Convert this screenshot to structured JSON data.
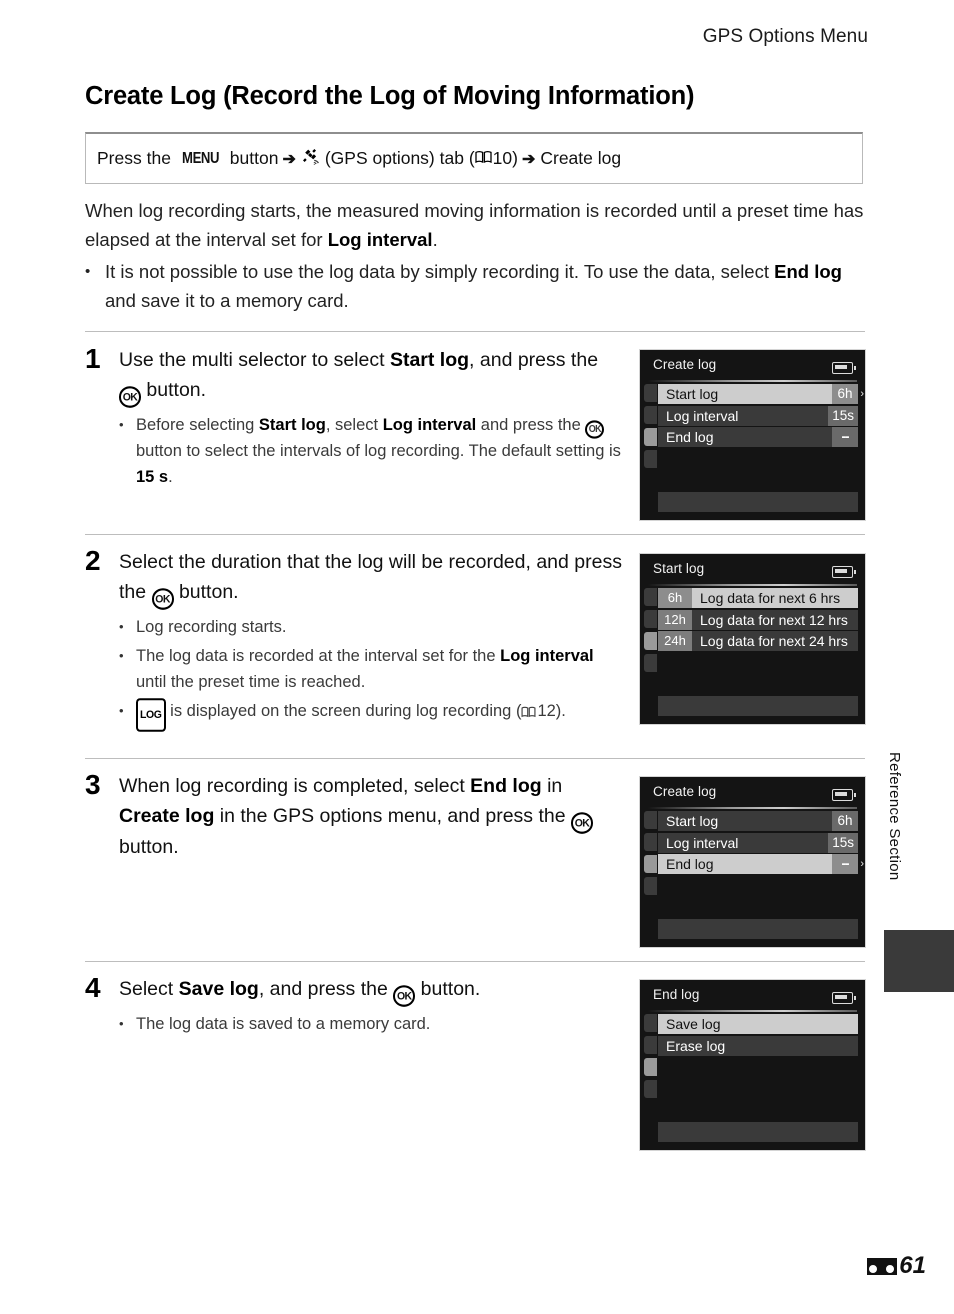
{
  "header": {
    "running_title": "GPS Options Menu"
  },
  "section": {
    "title": "Create Log (Record the Log of Moving Information)"
  },
  "path_box": {
    "press_the": "Press the",
    "menu_label": "MENU",
    "button_word": "button",
    "arrow": "➔",
    "gps_icon": "satellite-icon",
    "gps_tab_label": "(GPS options) tab (",
    "book_icon": "book-icon",
    "page_ref": "10)",
    "close_paren": "",
    "arrow2": "➔",
    "destination": "Create log"
  },
  "intro": {
    "paragraph_a": "When log recording starts, the measured moving information is recorded until a preset time has elapsed at the interval set for ",
    "paragraph_a_bold": "Log interval",
    "paragraph_a_end": ".",
    "bullet_dot": "•",
    "bullet_a": "It is not possible to use the log data by simply recording it. To use the data, select ",
    "bullet_a_bold": "End log",
    "bullet_a_end": " and save it to a memory card."
  },
  "steps": [
    {
      "number": "1",
      "head_pre": "Use the multi selector to select ",
      "head_bold": "Start log",
      "head_mid": ", and press the ",
      "ok_glyph": "OK",
      "head_end": " button.",
      "subs": [
        {
          "dot": "•",
          "pre": "Before selecting ",
          "b1": "Start log",
          "mid1": ", select ",
          "b2": "Log interval",
          "mid2": " and press the ",
          "ok": "OK",
          "mid3": " button to select the intervals of log recording. The default setting is ",
          "b3": "15 s",
          "end": "."
        }
      ]
    },
    {
      "number": "2",
      "head_pre": "Select the duration that the log will be recorded, and press the ",
      "ok_glyph": "OK",
      "head_end": " button.",
      "subs": [
        {
          "dot": "•",
          "text": "Log recording starts."
        },
        {
          "dot": "•",
          "pre": "The log data is recorded at the interval set for the ",
          "b1": "Log interval",
          "end": " until the preset time is reached."
        },
        {
          "dot": "•",
          "log_glyph": "LOG",
          "pre": " is displayed on the screen during log recording (",
          "book_icon": "book-icon",
          "page_ref": "12)."
        }
      ]
    },
    {
      "number": "3",
      "head_pre": "When log recording is completed, select ",
      "head_bold": "End log",
      "head_mid": " in ",
      "head_bold2": "Create log",
      "head_mid2": " in the GPS options menu, and press the ",
      "ok_glyph": "OK",
      "head_end": " button.",
      "subs": []
    },
    {
      "number": "4",
      "head_pre": "Select ",
      "head_bold": "Save log",
      "head_mid": ", and press the ",
      "ok_glyph": "OK",
      "head_end": " button.",
      "subs": [
        {
          "dot": "•",
          "text": "The log data is saved to a memory card."
        }
      ]
    }
  ],
  "screens": [
    {
      "name": "create-log-start-selected",
      "title": "Create log",
      "battery_icon": "battery-icon",
      "rows": [
        {
          "label": "Start log",
          "value": "6h",
          "selected": true,
          "caret": "›"
        },
        {
          "label": "Log interval",
          "value": "15s",
          "selected": false,
          "caret": ""
        },
        {
          "label": "End log",
          "value": "--",
          "selected": false,
          "caret": ""
        }
      ]
    },
    {
      "name": "start-log-options",
      "title": "Start log",
      "battery_icon": "battery-icon",
      "options": [
        {
          "badge": "6h",
          "text": "Log data for next 6 hrs",
          "selected": true
        },
        {
          "badge": "12h",
          "text": "Log data for next 12 hrs",
          "selected": false
        },
        {
          "badge": "24h",
          "text": "Log data for next 24 hrs",
          "selected": false
        }
      ]
    },
    {
      "name": "create-log-end-selected",
      "title": "Create log",
      "battery_icon": "battery-icon",
      "rows": [
        {
          "label": "Start log",
          "value": "6h",
          "selected": false,
          "caret": ""
        },
        {
          "label": "Log interval",
          "value": "15s",
          "selected": false,
          "caret": ""
        },
        {
          "label": "End log",
          "value": "--",
          "selected": true,
          "caret": "›"
        }
      ]
    },
    {
      "name": "end-log-options",
      "title": "End log",
      "battery_icon": "battery-icon",
      "rows": [
        {
          "label": "Save log",
          "value": "",
          "selected": true,
          "caret": ""
        },
        {
          "label": "Erase log",
          "value": "",
          "selected": false,
          "caret": ""
        }
      ]
    }
  ],
  "side": {
    "label": "Reference Section"
  },
  "footer": {
    "section_glyph": "E",
    "page_number": "61"
  }
}
